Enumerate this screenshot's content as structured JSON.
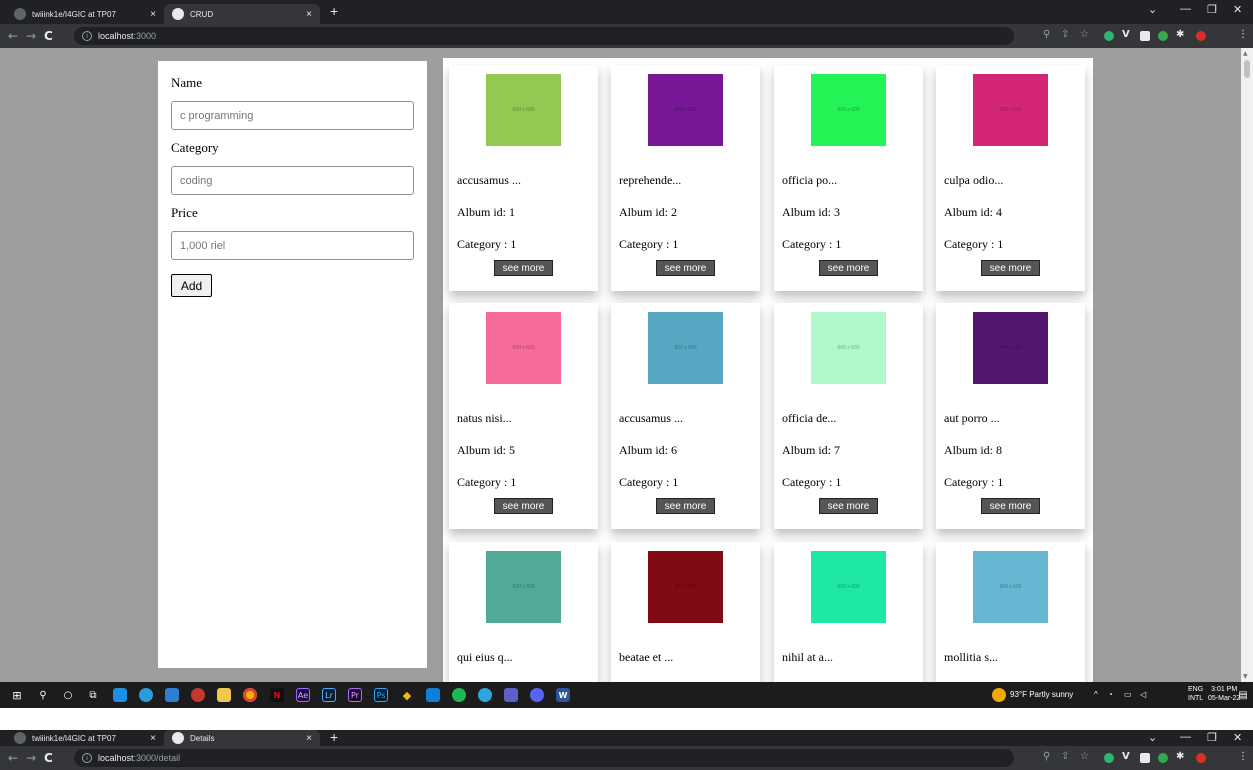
{
  "window1": {
    "tabs": [
      {
        "title": "twiiink1e/I4GIC at TP07",
        "close": "×"
      },
      {
        "title": "CRUD",
        "close": "×"
      }
    ],
    "new_tab": "+",
    "window_controls": {
      "minimize": "—",
      "maximize": "❐",
      "close": "✕",
      "dropdown": "⌄"
    },
    "nav": {
      "back": "←",
      "forward": "→",
      "reload": "C"
    },
    "address": {
      "host": "localhost",
      "path": ":3000"
    }
  },
  "form": {
    "name_label": "Name",
    "name_value": "c programming",
    "category_label": "Category",
    "category_value": "coding",
    "price_label": "Price",
    "price_placeholder": "1,000 riel",
    "add_label": "Add"
  },
  "cards": [
    {
      "title": "accusamus ...",
      "album": "Album id: 1",
      "category": "Category : 1",
      "thumb_text": "600 x 600",
      "color": "#92c952",
      "button": "see more"
    },
    {
      "title": "reprehende...",
      "album": "Album id: 2",
      "category": "Category : 1",
      "thumb_text": "600 x 600",
      "color": "#771796",
      "button": "see more"
    },
    {
      "title": "officia po...",
      "album": "Album id: 3",
      "category": "Category : 1",
      "thumb_text": "600 x 600",
      "color": "#24f355",
      "button": "see more"
    },
    {
      "title": "culpa odio...",
      "album": "Album id: 4",
      "category": "Category : 1",
      "thumb_text": "600 x 600",
      "color": "#d32776",
      "button": "see more"
    },
    {
      "title": "natus nisi...",
      "album": "Album id: 5",
      "category": "Category : 1",
      "thumb_text": "600 x 600",
      "color": "#f66b97",
      "button": "see more"
    },
    {
      "title": "accusamus ...",
      "album": "Album id: 6",
      "category": "Category : 1",
      "thumb_text": "600 x 600",
      "color": "#56a8c2",
      "button": "see more"
    },
    {
      "title": "officia de...",
      "album": "Album id: 7",
      "category": "Category : 1",
      "thumb_text": "600 x 600",
      "color": "#b0f7cc",
      "button": "see more"
    },
    {
      "title": "aut porro ...",
      "album": "Album id: 8",
      "category": "Category : 1",
      "thumb_text": "600 x 600",
      "color": "#54176f",
      "button": "see more"
    },
    {
      "title": "qui eius q...",
      "thumb_text": "600 x 600",
      "color": "#51aa97"
    },
    {
      "title": "beatae et ...",
      "thumb_text": "600 x 600",
      "color": "#810b14"
    },
    {
      "title": "nihil at a...",
      "thumb_text": "600 x 600",
      "color": "#1ee8a4"
    },
    {
      "title": "mollitia s...",
      "thumb_text": "600 x 600",
      "color": "#66b7d2"
    }
  ],
  "taskbar": {
    "weather": "93°F Partly sunny",
    "lang_top": "ENG",
    "lang_bottom": "INTL",
    "time": "3:01 PM",
    "date": "05-Mar-22"
  },
  "window2": {
    "tabs": [
      {
        "title": "twiiink1e/I4GIC at TP07",
        "close": "×"
      },
      {
        "title": "Details",
        "close": "×"
      }
    ],
    "new_tab": "+",
    "address": {
      "host": "localhost",
      "path": ":3000/detail"
    }
  },
  "colors": {
    "page_bg": "#9e9e9e",
    "button_bg": "#555555",
    "chrome_dark": "#202124",
    "chrome_mid": "#35363a"
  }
}
